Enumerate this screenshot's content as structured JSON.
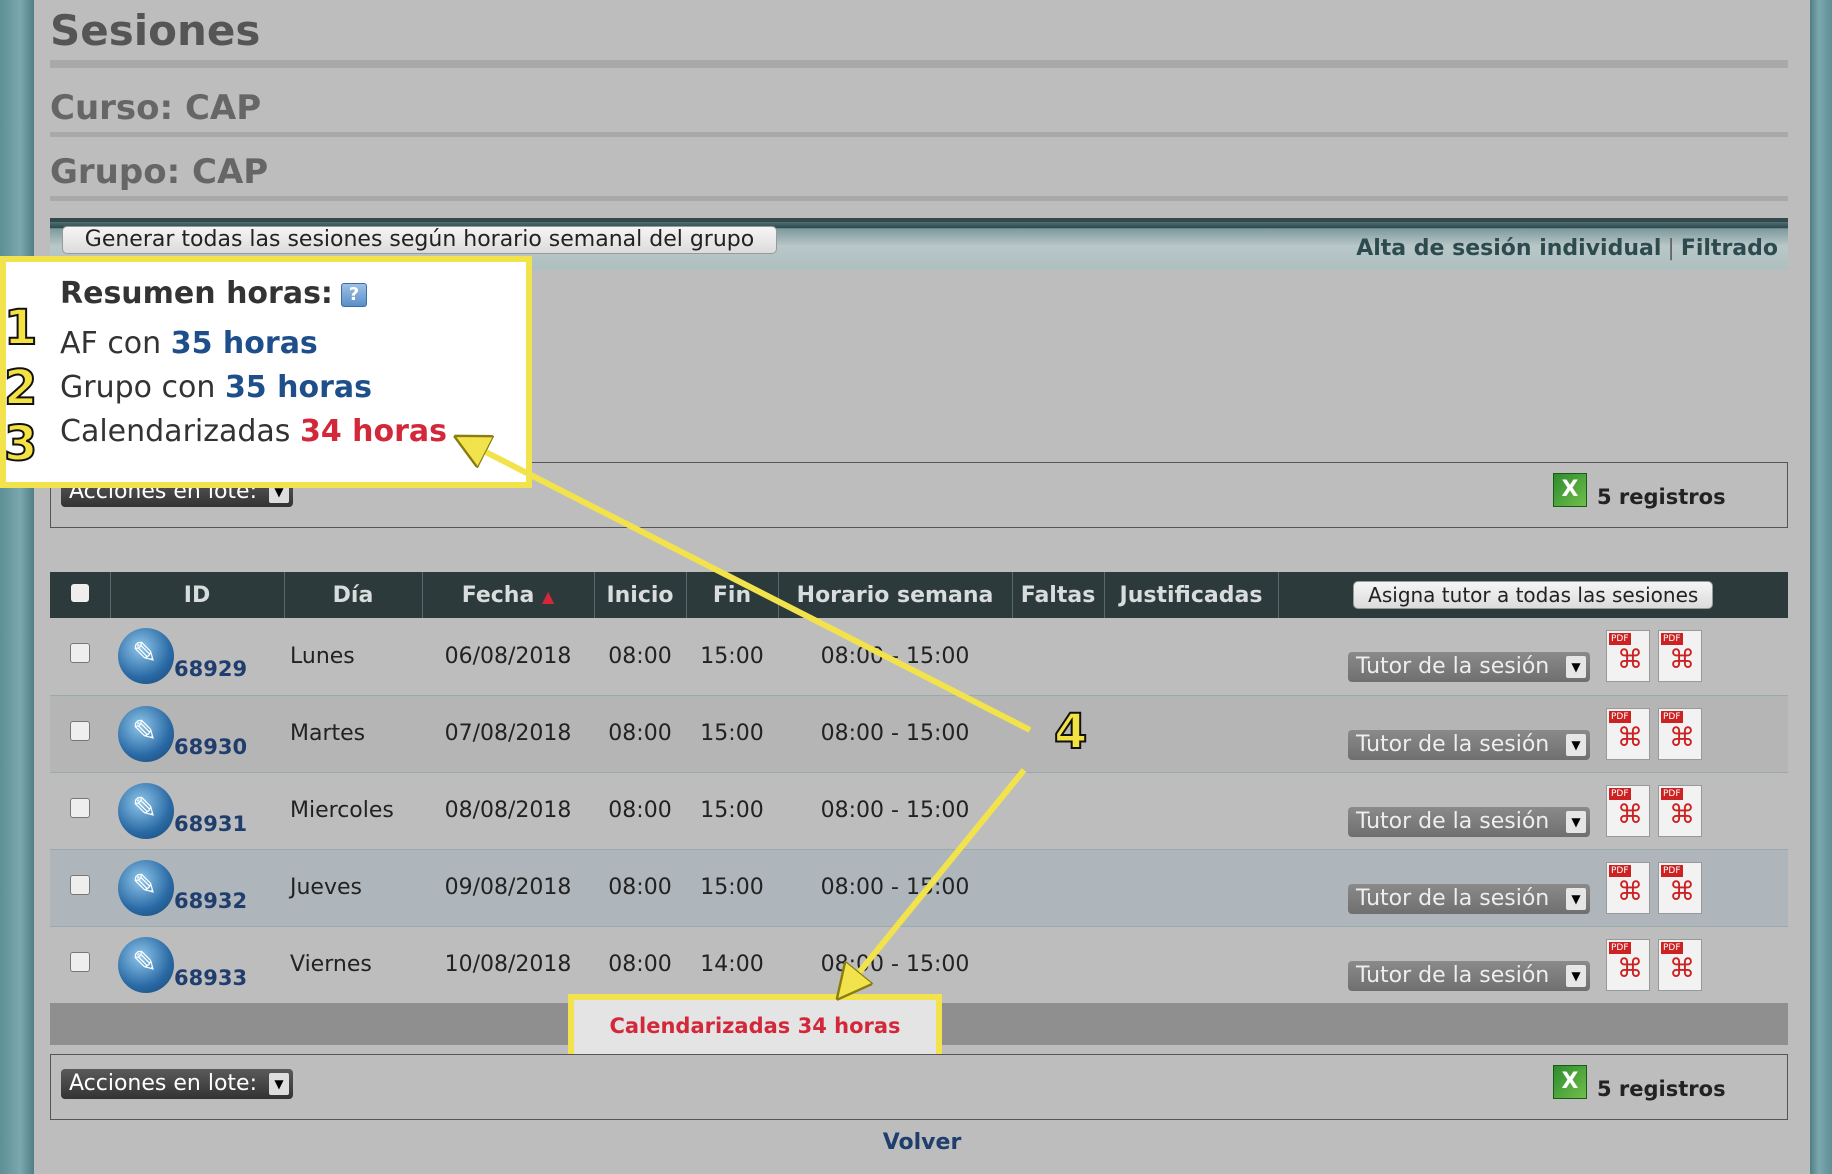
{
  "page": {
    "title": "Sesiones",
    "curso": "Curso: CAP",
    "grupo": "Grupo: CAP",
    "back_link": "Volver"
  },
  "toolbar": {
    "generate_button": "Generar todas las sesiones según horario semanal del grupo",
    "alta_link": "Alta de sesión individual",
    "separator": "|",
    "filtrado_link": "Filtrado"
  },
  "summary": {
    "heading": "Resumen horas:",
    "help_icon": "?",
    "af_label": "AF con",
    "af_value": "35 horas",
    "grupo_label": "Grupo con",
    "grupo_value": "35 horas",
    "cal_label": "Calendarizadas",
    "cal_value": "34 horas"
  },
  "batch": {
    "label": "Acciones en lote:",
    "records": "5 registros",
    "excel_icon": "excel-icon"
  },
  "table": {
    "headers": [
      "",
      "ID",
      "Día",
      "Fecha",
      "Inicio",
      "Fin",
      "Horario semana",
      "Faltas",
      "Justificadas"
    ],
    "sort_indicator": "▲",
    "assign_button": "Asigna tutor a todas las sesiones",
    "tutor_placeholder": "Tutor de la sesión",
    "rows": [
      {
        "id": "68929",
        "dia": "Lunes",
        "fecha": "06/08/2018",
        "inicio": "08:00",
        "fin": "15:00",
        "horario": "08:00 - 15:00"
      },
      {
        "id": "68930",
        "dia": "Martes",
        "fecha": "07/08/2018",
        "inicio": "08:00",
        "fin": "15:00",
        "horario": "08:00 - 15:00"
      },
      {
        "id": "68931",
        "dia": "Miercoles",
        "fecha": "08/08/2018",
        "inicio": "08:00",
        "fin": "15:00",
        "horario": "08:00 - 15:00"
      },
      {
        "id": "68932",
        "dia": "Jueves",
        "fecha": "09/08/2018",
        "inicio": "08:00",
        "fin": "15:00",
        "horario": "08:00 - 15:00"
      },
      {
        "id": "68933",
        "dia": "Viernes",
        "fecha": "10/08/2018",
        "inicio": "08:00",
        "fin": "14:00",
        "horario": "08:00 - 15:00"
      }
    ],
    "footer_total": "Calendarizadas 34 horas"
  },
  "annotations": {
    "n1": "1",
    "n2": "2",
    "n3": "3",
    "n4": "4",
    "highlight_color": "#f2e24c"
  },
  "colors": {
    "blue_value": "#1f4f8a",
    "red_value": "#d3283a",
    "header_bg": "#2d3a3c"
  }
}
